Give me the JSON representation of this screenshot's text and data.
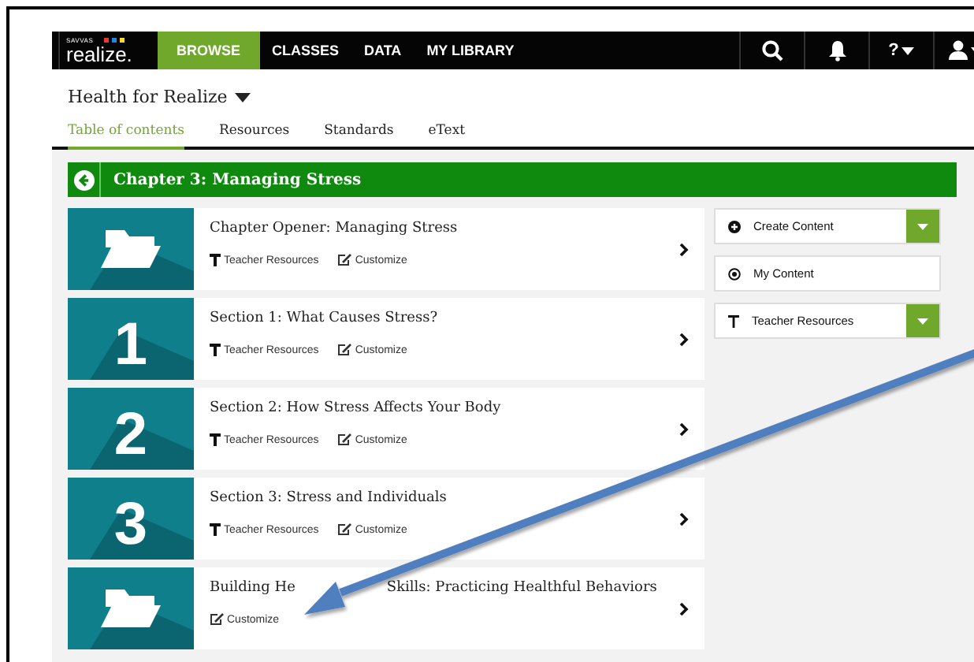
{
  "navbar": {
    "logo": {
      "maker": "SAVVAS",
      "name": "realize."
    },
    "items": [
      {
        "label": "BROWSE",
        "selected": true
      },
      {
        "label": "CLASSES",
        "selected": false
      },
      {
        "label": "DATA",
        "selected": false
      },
      {
        "label": "MY LIBRARY",
        "selected": false
      }
    ],
    "help": {
      "label": "?"
    }
  },
  "header": {
    "title": "Health for Realize",
    "tabs": [
      {
        "label": "Table of contents",
        "selected": true
      },
      {
        "label": "Resources",
        "selected": false
      },
      {
        "label": "Standards",
        "selected": false
      },
      {
        "label": "eText",
        "selected": false
      }
    ]
  },
  "chapter": {
    "title": "Chapter 3: Managing Stress"
  },
  "lessons": [
    {
      "thumb": {
        "kind": "folder"
      },
      "title": "Chapter Opener: Managing Stress",
      "links": [
        {
          "kind": "teacher",
          "label": "Teacher Resources"
        },
        {
          "kind": "customize",
          "label": "Customize"
        }
      ]
    },
    {
      "thumb": {
        "kind": "number",
        "number": "1"
      },
      "title": "Section 1: What Causes Stress?",
      "links": [
        {
          "kind": "teacher",
          "label": "Teacher Resources"
        },
        {
          "kind": "customize",
          "label": "Customize"
        }
      ]
    },
    {
      "thumb": {
        "kind": "number",
        "number": "2"
      },
      "title": "Section 2: How Stress Affects Your Body",
      "links": [
        {
          "kind": "teacher",
          "label": "Teacher Resources"
        },
        {
          "kind": "customize",
          "label": "Customize"
        }
      ]
    },
    {
      "thumb": {
        "kind": "number",
        "number": "3"
      },
      "title": "Section 3: Stress and Individuals",
      "links": [
        {
          "kind": "teacher",
          "label": "Teacher Resources"
        },
        {
          "kind": "customize",
          "label": "Customize"
        }
      ]
    },
    {
      "thumb": {
        "kind": "folder"
      },
      "title": "Building He",
      "title_rest": "Skills: Practicing Healthful Behaviors",
      "links": [
        {
          "kind": "customize",
          "label": "Customize"
        }
      ]
    }
  ],
  "actions": [
    {
      "kind": "create",
      "label": "Create Content",
      "dropdown": true
    },
    {
      "kind": "mine",
      "label": "My Content",
      "dropdown": false
    },
    {
      "kind": "teacher",
      "label": "Teacher Resources",
      "dropdown": true
    }
  ]
}
